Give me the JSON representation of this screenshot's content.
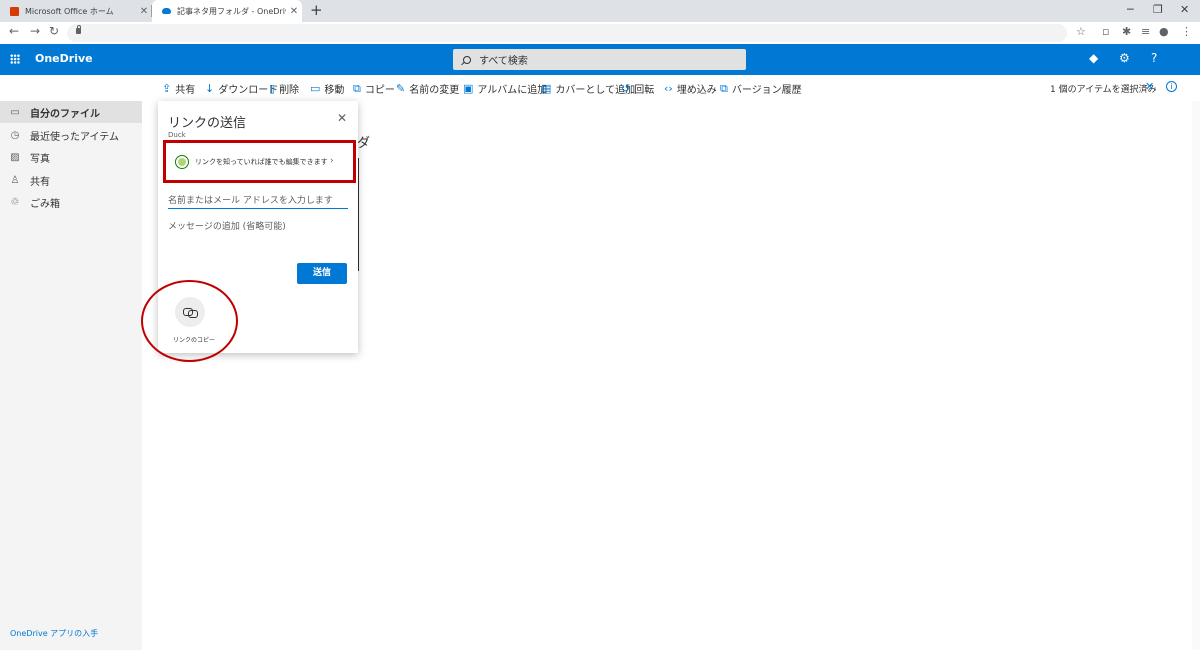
{
  "browser": {
    "tabs": [
      {
        "title": "Microsoft Office ホーム",
        "icon": "office-icon"
      },
      {
        "title": "記事ネタ用フォルダ - OneDrive",
        "icon": "onedrive-cloud-icon"
      }
    ],
    "new_tab": "+",
    "close": "✕"
  },
  "header": {
    "brand": "OneDrive",
    "search_placeholder": "すべて検索",
    "accent": "#0078d4"
  },
  "commands": [
    {
      "label": "共有",
      "icon": "share-icon"
    },
    {
      "label": "ダウンロード",
      "icon": "download-icon"
    },
    {
      "label": "削除",
      "icon": "delete-icon"
    },
    {
      "label": "移動",
      "icon": "move-icon"
    },
    {
      "label": "コピー",
      "icon": "copy-icon"
    },
    {
      "label": "名前の変更",
      "icon": "rename-icon"
    },
    {
      "label": "アルバムに追加",
      "icon": "album-icon"
    },
    {
      "label": "カバーとして追加",
      "icon": "cover-icon"
    },
    {
      "label": "回転",
      "icon": "rotate-icon"
    },
    {
      "label": "埋め込み",
      "icon": "embed-icon"
    },
    {
      "label": "バージョン履歴",
      "icon": "version-history-icon"
    }
  ],
  "selection": {
    "text": "1 個のアイテムを選択済み"
  },
  "sidebar": {
    "items": [
      {
        "label": "自分のファイル",
        "icon": "folder-icon",
        "active": true
      },
      {
        "label": "最近使ったアイテム",
        "icon": "recent-icon"
      },
      {
        "label": "写真",
        "icon": "photo-icon"
      },
      {
        "label": "共有",
        "icon": "shared-icon"
      },
      {
        "label": "ごみ箱",
        "icon": "recycle-bin-icon"
      }
    ],
    "get_app": "OneDrive アプリの入手"
  },
  "background": {
    "title_fragment": "ダ"
  },
  "share_panel": {
    "title": "リンクの送信",
    "subtitle": "Duck",
    "permission": "リンクを知っていれば誰でも編集できます",
    "recipient_placeholder": "名前またはメール アドレスを入力します",
    "message_placeholder": "メッセージの追加 (省略可能)",
    "send_label": "送信",
    "copy_link_label": "リンクのコピー"
  },
  "annotation": {
    "color": "#c00000"
  }
}
